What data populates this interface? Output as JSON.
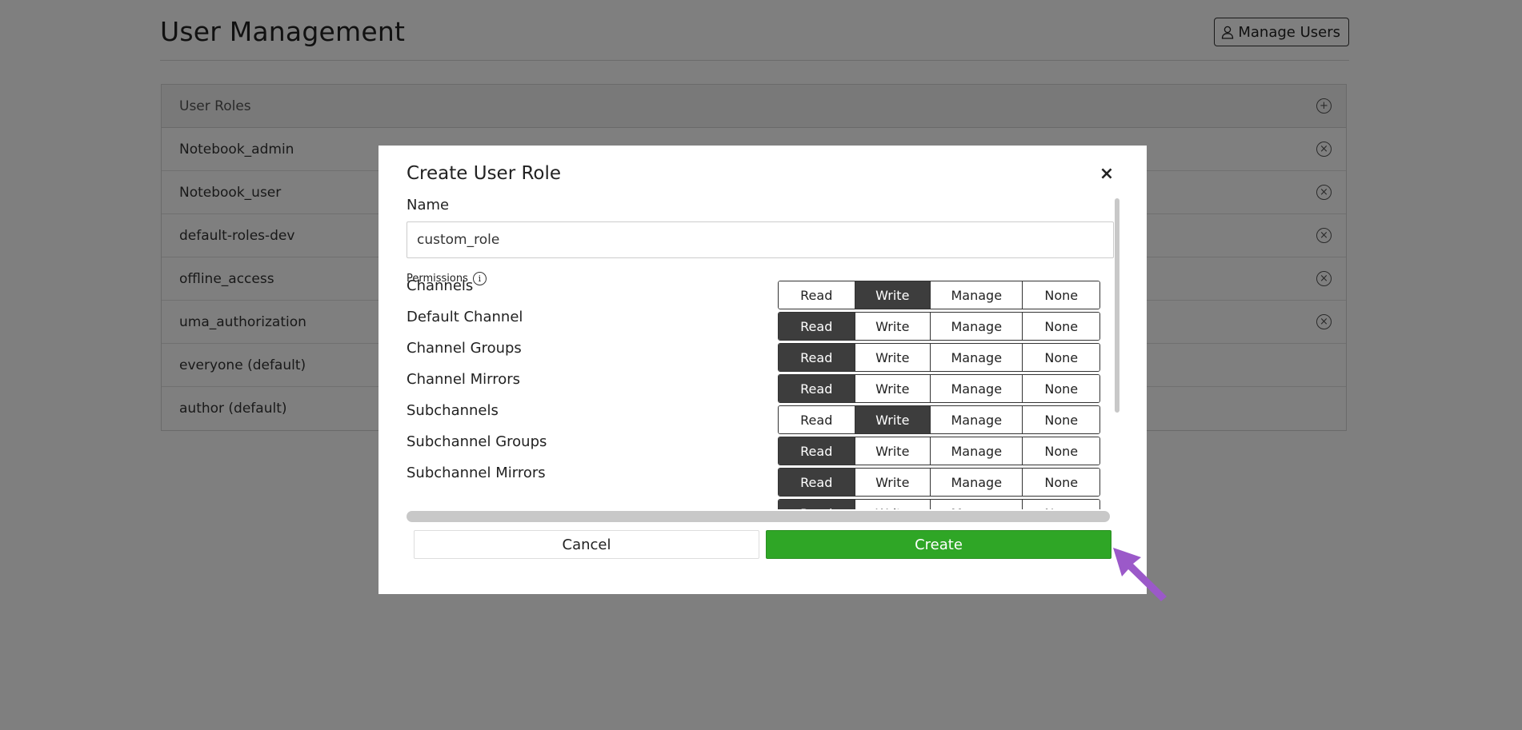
{
  "header": {
    "title": "User Management",
    "manage_users_label": "Manage Users"
  },
  "roles": {
    "header_label": "User Roles",
    "items": [
      {
        "name": "Notebook_admin",
        "deletable": true
      },
      {
        "name": "Notebook_user",
        "deletable": true
      },
      {
        "name": "default-roles-dev",
        "deletable": true
      },
      {
        "name": "offline_access",
        "deletable": true
      },
      {
        "name": "uma_authorization",
        "deletable": true
      },
      {
        "name": "everyone (default)",
        "deletable": false
      },
      {
        "name": "author (default)",
        "deletable": false
      }
    ]
  },
  "modal": {
    "title": "Create User Role",
    "close_glyph": "×",
    "name_label": "Name",
    "name_value": "custom_role",
    "permissions_label": "Permissions",
    "info_glyph": "i",
    "options": [
      "Read",
      "Write",
      "Manage",
      "None"
    ],
    "permissions": [
      {
        "name": "Channels",
        "selected": "Write"
      },
      {
        "name": "Default Channel",
        "selected": "Read"
      },
      {
        "name": "Channel Groups",
        "selected": "Read"
      },
      {
        "name": "Channel Mirrors",
        "selected": "Read"
      },
      {
        "name": "Subchannels",
        "selected": "Write"
      },
      {
        "name": "Subchannel Groups",
        "selected": "Read"
      },
      {
        "name": "Subchannel Mirrors",
        "selected": "Read"
      },
      {
        "name": "",
        "selected": "Read"
      }
    ],
    "cancel_label": "Cancel",
    "create_label": "Create"
  },
  "colors": {
    "create_button": "#2fa626",
    "selected_option": "#3d3d3d",
    "cursor_arrow": "#9b59c9"
  },
  "icons": {
    "add_role": "plus-circle-icon",
    "delete_role": "x-circle-icon",
    "manage_users": "user-icon",
    "permissions_info": "info-icon",
    "pointer": "cursor-arrow-icon"
  }
}
